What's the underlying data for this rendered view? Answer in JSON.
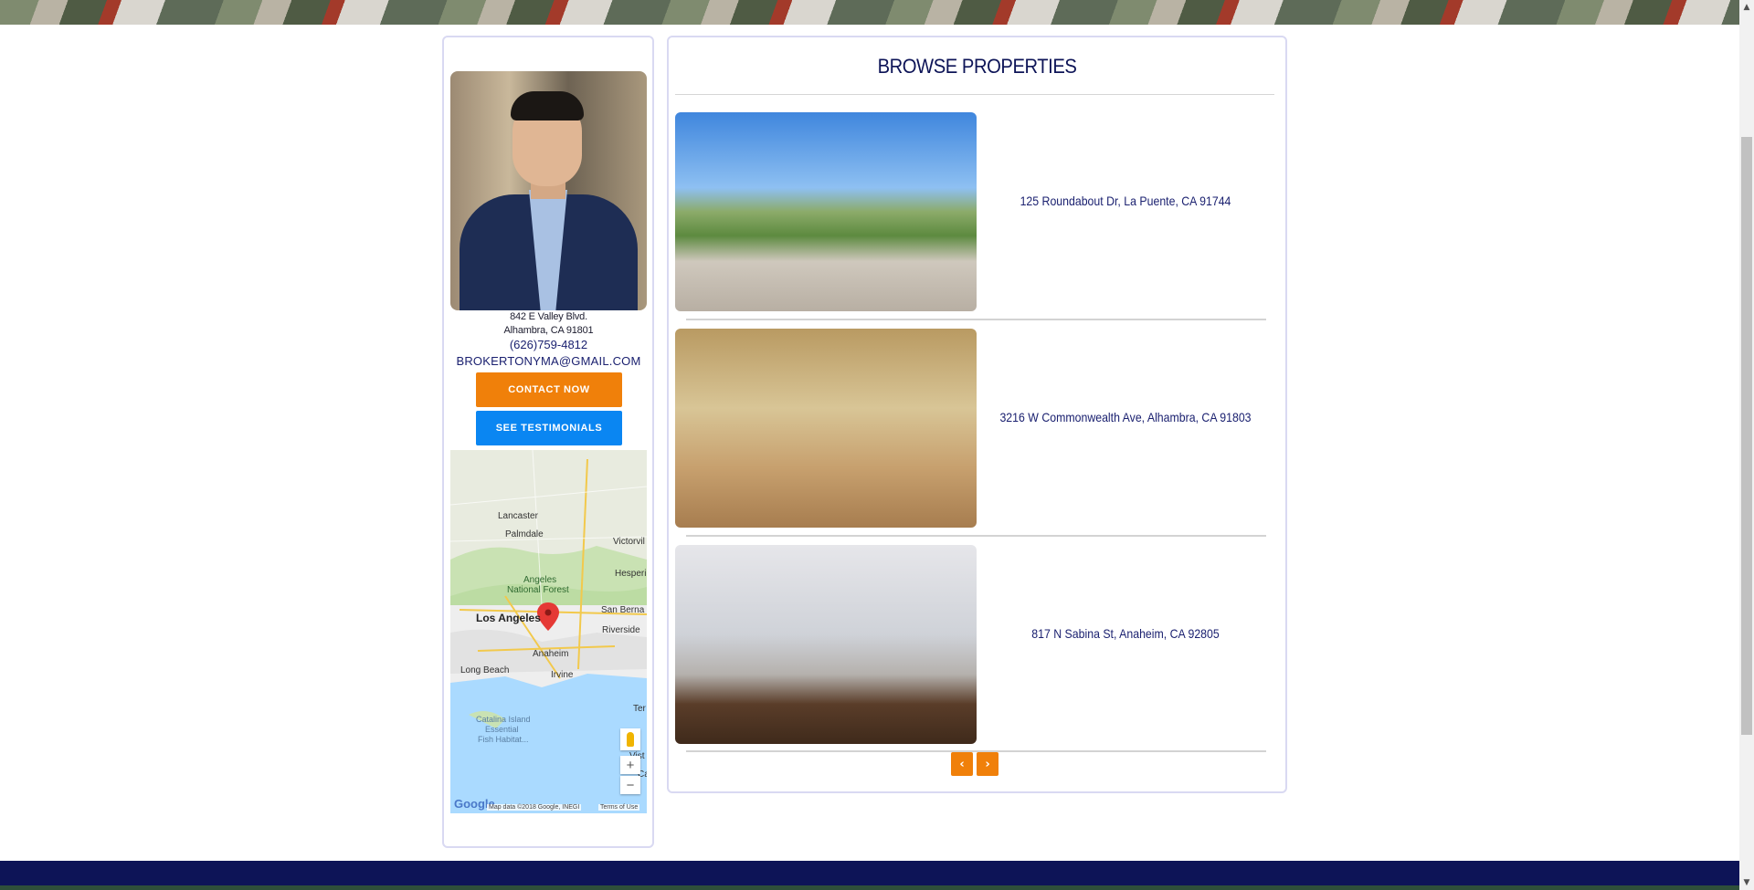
{
  "agent": {
    "address_line1": "842 E Valley Blvd.",
    "address_line2": "Alhambra, CA 91801",
    "phone": "(626)759-4812",
    "email": "BROKERTONYMA@GMAIL.COM",
    "contact_button": "CONTACT NOW",
    "testimonials_button": "SEE TESTIMONIALS"
  },
  "map": {
    "labels": {
      "lancaster": "Lancaster",
      "palmdale": "Palmdale",
      "victorville": "Victorvil",
      "forest_line1": "Angeles",
      "forest_line2": "National Forest",
      "hesperia": "Hesperi",
      "los_angeles": "Los Angeles",
      "san_bernardino": "San Berna",
      "riverside": "Riverside",
      "anaheim": "Anaheim",
      "long_beach": "Long Beach",
      "irvine": "Irvine",
      "temecula": "Ter",
      "catalina_line1": "Catalina Island",
      "catalina_line2": "Essential",
      "catalina_line3": "Fish Habitat...",
      "vista": "Vist",
      "carlsbad": "Ca"
    },
    "zoom_in": "+",
    "zoom_out": "−",
    "google_logo": "Google",
    "attribution": "Map data ©2018 Google, INEGI",
    "terms": "Terms of Use"
  },
  "browse": {
    "title": "BROWSE PROPERTIES",
    "properties": [
      {
        "address": "125 Roundabout Dr, La Puente, CA 91744"
      },
      {
        "address": "3216 W Commonwealth Ave, Alhambra, CA 91803"
      },
      {
        "address": "817 N Sabina St, Anaheim, CA 92805"
      }
    ],
    "prev": "‹",
    "next": "›"
  },
  "scrollbar": {
    "up": "▲",
    "down": "▼"
  },
  "colors": {
    "navy": "#0d1457",
    "orange": "#f0800a",
    "blue_button": "#0a86f2",
    "panel_border": "#d9d9f2"
  }
}
